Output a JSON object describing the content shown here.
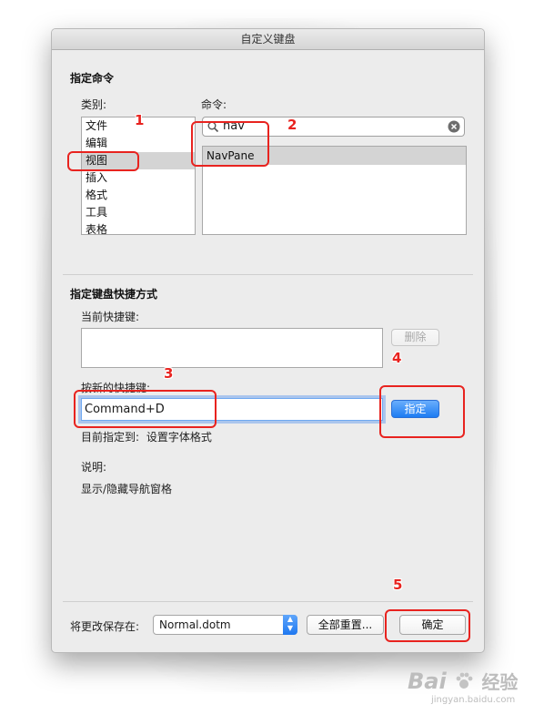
{
  "window": {
    "title": "自定义键盘"
  },
  "assign_command": {
    "section_title": "指定命令",
    "category_label": "类别:",
    "command_label": "命令:",
    "categories": [
      "文件",
      "编辑",
      "视图",
      "插入",
      "格式",
      "工具",
      "表格"
    ],
    "selected_category_index": 2,
    "search": {
      "value": "nav"
    },
    "commands": [
      "NavPane"
    ]
  },
  "shortcut": {
    "section_title": "指定键盘快捷方式",
    "current_label": "当前快捷键:",
    "delete_button": "删除",
    "new_label": "按新的快捷键:",
    "new_value": "Command+D",
    "assign_button": "指定",
    "currently_assigned_label": "目前指定到:",
    "currently_assigned_value": "设置字体格式",
    "description_label": "说明:",
    "description_value": "显示/隐藏导航窗格"
  },
  "footer": {
    "save_in_label": "将更改保存在:",
    "save_in_value": "Normal.dotm",
    "reset_all_button": "全部重置...",
    "ok_button": "确定"
  },
  "annotations": [
    "1",
    "2",
    "3",
    "4",
    "5"
  ],
  "watermark": {
    "brand": "Bai",
    "brand2": "经验",
    "url": "jingyan.baidu.com"
  },
  "colors": {
    "annotation": "#e8231f",
    "primary": "#1d7cf2"
  }
}
